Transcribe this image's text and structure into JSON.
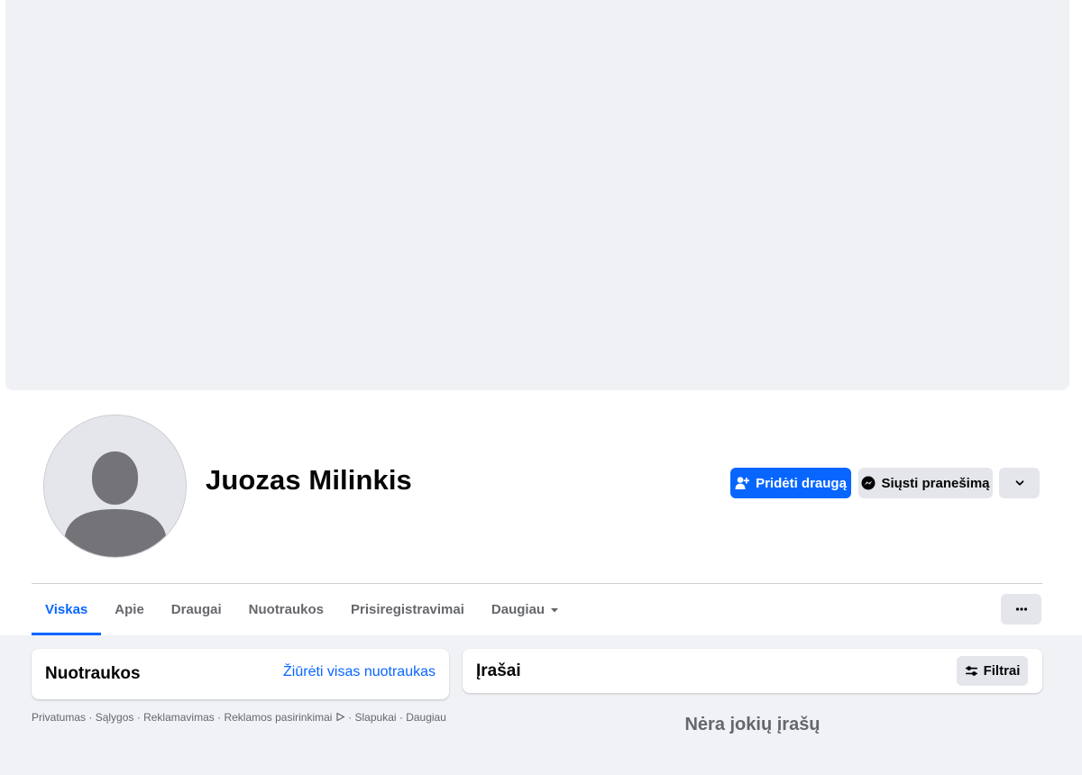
{
  "profile": {
    "name": "Juozas Milinkis"
  },
  "actions": {
    "add_friend_label": "Pridėti draugą",
    "message_label": "Siųsti pranešimą"
  },
  "tabs": [
    {
      "label": "Viskas",
      "active": true
    },
    {
      "label": "Apie",
      "active": false
    },
    {
      "label": "Draugai",
      "active": false
    },
    {
      "label": "Nuotraukos",
      "active": false
    },
    {
      "label": "Prisiregistravimai",
      "active": false
    },
    {
      "label": "Daugiau",
      "active": false
    }
  ],
  "photos_card": {
    "title": "Nuotraukos",
    "link": "Žiūrėti visas nuotraukas"
  },
  "posts_card": {
    "title": "Įrašai",
    "filter_label": "Filtrai",
    "empty_text": "Nėra jokių įrašų"
  },
  "footer": {
    "links": [
      "Privatumas",
      "Sąlygos",
      "Reklamavimas",
      "Reklamos pasirinkimai",
      "Slapukai",
      "Daugiau"
    ],
    "separator": " · "
  },
  "colors": {
    "accent": "#0866ff",
    "background": "#f0f2f5",
    "secondary_button": "#e4e6eb"
  }
}
